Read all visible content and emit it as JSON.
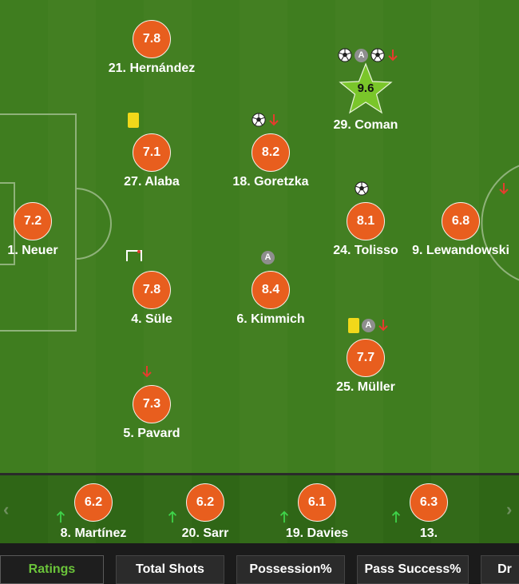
{
  "starters": [
    {
      "id": "hernandez",
      "name": "21. Hernández",
      "rating": "7.8",
      "icons": []
    },
    {
      "id": "coman",
      "name": "29. Coman",
      "rating": "9.6",
      "star": true,
      "icons": [
        "ball",
        "armband",
        "ball",
        "arrow-down"
      ]
    },
    {
      "id": "alaba",
      "name": "27. Alaba",
      "rating": "7.1",
      "icons": [
        "yellow-card"
      ]
    },
    {
      "id": "goretzka",
      "name": "18. Goretzka",
      "rating": "8.2",
      "icons": [
        "ball",
        "arrow-down"
      ]
    },
    {
      "id": "neuer",
      "name": "1. Neuer",
      "rating": "7.2",
      "icons": []
    },
    {
      "id": "tolisso",
      "name": "24. Tolisso",
      "rating": "8.1",
      "icons": [
        "ball"
      ]
    },
    {
      "id": "lewandowski",
      "name": "9. Lewandowski",
      "rating": "6.8",
      "icons": [
        "arrow-down"
      ]
    },
    {
      "id": "sule",
      "name": "4. Süle",
      "rating": "7.8",
      "icons": [
        "goal-frame"
      ]
    },
    {
      "id": "kimmich",
      "name": "6. Kimmich",
      "rating": "8.4",
      "icons": [
        "armband"
      ]
    },
    {
      "id": "muller",
      "name": "25. Müller",
      "rating": "7.7",
      "icons": [
        "yellow-card",
        "armband",
        "arrow-down"
      ]
    },
    {
      "id": "pavard",
      "name": "5. Pavard",
      "rating": "7.3",
      "icons": [
        "arrow-down"
      ]
    }
  ],
  "armband_letter": "A",
  "bench": [
    {
      "id": "martinez",
      "name": "8. Martínez",
      "rating": "6.2"
    },
    {
      "id": "sarr",
      "name": "20. Sarr",
      "rating": "6.2"
    },
    {
      "id": "davies",
      "name": "19. Davies",
      "rating": "6.1"
    },
    {
      "id": "thirteen",
      "name": "13.",
      "rating": "6.3"
    }
  ],
  "bench_nav": {
    "prev": "‹",
    "next": "›"
  },
  "tabs": [
    "Ratings",
    "Total Shots",
    "Possession%",
    "Pass Success%",
    "Dr"
  ],
  "active_tab": "Ratings",
  "colors": {
    "rating_badge": "#e85e1e",
    "star_badge": "#7ac62a",
    "yellow_card": "#f1d81a",
    "sub_off_arrow": "#e53c2e",
    "sub_on_arrow": "#3fd44a",
    "active_tab_text": "#6bc43a",
    "armband": "#8e8e8e"
  }
}
